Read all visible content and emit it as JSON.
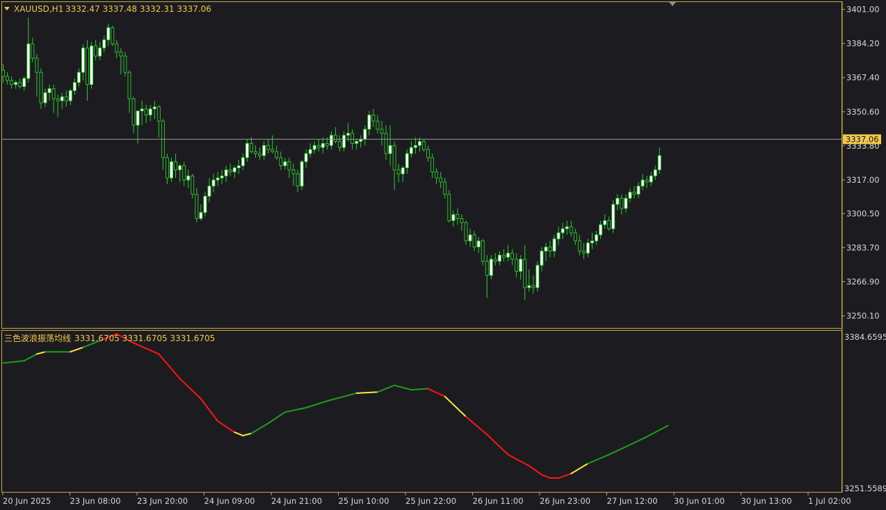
{
  "window": {
    "title_symbol": "XAUUSD,H1",
    "ohlc_text": "3332.47 3337.48 3332.31 3337.06"
  },
  "colors": {
    "background": "#1c1c20",
    "frame": "#c8a84b",
    "bull_candle": "#ffffff",
    "bear_candle": "#1c1c20",
    "wick": "#32c832",
    "price_line": "#9a9a9a",
    "price_tag_bg": "#f2c94c",
    "osc_green": "#1f9d1f",
    "osc_red": "#ff1414",
    "osc_yellow": "#ffe64a",
    "text": "#d8d8d8"
  },
  "indicator": {
    "name": "三色波浪振荡均线",
    "values_text": "3331.6705 3331.6705 3331.6705",
    "axis_max": "3384.6595",
    "axis_min": "3251.5589"
  },
  "current_price": {
    "label": "3337.06",
    "value": 3337.06
  },
  "time_labels": [
    "20 Jun 2025",
    "23 Jun 08:00",
    "23 Jun 20:00",
    "24 Jun 09:00",
    "24 Jun 21:00",
    "25 Jun 10:00",
    "25 Jun 22:00",
    "26 Jun 11:00",
    "26 Jun 23:00",
    "27 Jun 12:00",
    "30 Jun 01:00",
    "30 Jun 13:00",
    "1 Jul 02:00"
  ],
  "chart_data": {
    "type": "candlestick",
    "symbol": "XAUUSD",
    "timeframe": "H1",
    "y_ticks": [
      "3401.00",
      "3384.20",
      "3367.40",
      "3350.60",
      "3333.80",
      "3317.00",
      "3300.50",
      "3283.70",
      "3266.90",
      "3250.10"
    ],
    "ylim": [
      3246.5,
      3404.5
    ],
    "grid": false,
    "ohlc": [
      [
        3371,
        3374,
        3365,
        3368
      ],
      [
        3368,
        3370,
        3364,
        3366
      ],
      [
        3366,
        3368,
        3362,
        3364
      ],
      [
        3364,
        3366,
        3362,
        3365
      ],
      [
        3365,
        3367,
        3362,
        3363
      ],
      [
        3363,
        3368,
        3361,
        3367
      ],
      [
        3367,
        3397,
        3365,
        3384
      ],
      [
        3384,
        3387,
        3375,
        3377
      ],
      [
        3377,
        3379,
        3358,
        3370
      ],
      [
        3370,
        3372,
        3352,
        3355
      ],
      [
        3355,
        3362,
        3353,
        3360
      ],
      [
        3360,
        3364,
        3356,
        3362
      ],
      [
        3362,
        3364,
        3350,
        3357
      ],
      [
        3357,
        3359,
        3348,
        3356
      ],
      [
        3356,
        3360,
        3352,
        3358
      ],
      [
        3358,
        3361,
        3353,
        3356
      ],
      [
        3356,
        3362,
        3354,
        3361
      ],
      [
        3361,
        3367,
        3359,
        3365
      ],
      [
        3365,
        3372,
        3363,
        3370
      ],
      [
        3370,
        3384,
        3366,
        3382
      ],
      [
        3382,
        3386,
        3356,
        3364
      ],
      [
        3364,
        3385,
        3362,
        3383
      ],
      [
        3383,
        3386,
        3376,
        3378
      ],
      [
        3378,
        3385,
        3376,
        3382
      ],
      [
        3382,
        3388,
        3380,
        3386
      ],
      [
        3386,
        3394,
        3383,
        3392
      ],
      [
        3392,
        3393,
        3383,
        3384
      ],
      [
        3384,
        3386,
        3377,
        3380
      ],
      [
        3380,
        3382,
        3369,
        3378
      ],
      [
        3378,
        3380,
        3368,
        3370
      ],
      [
        3370,
        3371,
        3350,
        3357
      ],
      [
        3357,
        3358,
        3340,
        3344
      ],
      [
        3344,
        3346,
        3335,
        3351
      ],
      [
        3351,
        3356,
        3344,
        3352
      ],
      [
        3352,
        3354,
        3345,
        3349
      ],
      [
        3349,
        3354,
        3346,
        3352
      ],
      [
        3352,
        3356,
        3347,
        3353
      ],
      [
        3353,
        3354,
        3338,
        3346
      ],
      [
        3346,
        3347,
        3322,
        3328
      ],
      [
        3328,
        3330,
        3315,
        3318
      ],
      [
        3318,
        3328,
        3316,
        3326
      ],
      [
        3326,
        3330,
        3318,
        3322
      ],
      [
        3322,
        3325,
        3316,
        3324
      ],
      [
        3324,
        3326,
        3314,
        3317
      ],
      [
        3317,
        3322,
        3313,
        3319
      ],
      [
        3319,
        3320,
        3308,
        3310
      ],
      [
        3310,
        3313,
        3296,
        3298
      ],
      [
        3298,
        3305,
        3297,
        3301
      ],
      [
        3301,
        3311,
        3299,
        3309
      ],
      [
        3309,
        3318,
        3306,
        3314
      ],
      [
        3314,
        3320,
        3311,
        3317
      ],
      [
        3317,
        3321,
        3314,
        3318
      ],
      [
        3318,
        3322,
        3315,
        3319
      ],
      [
        3319,
        3324,
        3316,
        3322
      ],
      [
        3322,
        3325,
        3319,
        3321
      ],
      [
        3321,
        3324,
        3318,
        3323
      ],
      [
        3323,
        3327,
        3320,
        3324
      ],
      [
        3324,
        3330,
        3322,
        3328
      ],
      [
        3328,
        3337,
        3326,
        3335
      ],
      [
        3335,
        3338,
        3330,
        3331
      ],
      [
        3331,
        3334,
        3328,
        3330
      ],
      [
        3330,
        3333,
        3327,
        3329
      ],
      [
        3329,
        3336,
        3327,
        3334
      ],
      [
        3334,
        3337,
        3330,
        3332
      ],
      [
        3332,
        3339,
        3330,
        3331
      ],
      [
        3331,
        3334,
        3327,
        3328
      ],
      [
        3328,
        3331,
        3322,
        3324
      ],
      [
        3324,
        3328,
        3322,
        3326
      ],
      [
        3326,
        3328,
        3318,
        3322
      ],
      [
        3322,
        3325,
        3314,
        3320
      ],
      [
        3320,
        3322,
        3311,
        3314
      ],
      [
        3314,
        3327,
        3312,
        3326
      ],
      [
        3326,
        3332,
        3323,
        3330
      ],
      [
        3330,
        3335,
        3328,
        3332
      ],
      [
        3332,
        3336,
        3330,
        3334
      ],
      [
        3334,
        3337,
        3331,
        3333
      ],
      [
        3333,
        3338,
        3330,
        3335
      ],
      [
        3335,
        3338,
        3332,
        3334
      ],
      [
        3334,
        3341,
        3332,
        3339
      ],
      [
        3339,
        3343,
        3335,
        3336
      ],
      [
        3336,
        3339,
        3331,
        3333
      ],
      [
        3333,
        3341,
        3331,
        3339
      ],
      [
        3339,
        3345,
        3336,
        3340
      ],
      [
        3340,
        3342,
        3332,
        3335
      ],
      [
        3335,
        3337,
        3332,
        3336
      ],
      [
        3336,
        3339,
        3333,
        3337
      ],
      [
        3337,
        3344,
        3334,
        3342
      ],
      [
        3342,
        3351,
        3339,
        3349
      ],
      [
        3349,
        3352,
        3343,
        3346
      ],
      [
        3346,
        3349,
        3340,
        3342
      ],
      [
        3342,
        3346,
        3334,
        3340
      ],
      [
        3340,
        3344,
        3327,
        3330
      ],
      [
        3330,
        3344,
        3324,
        3334
      ],
      [
        3334,
        3336,
        3312,
        3322
      ],
      [
        3322,
        3325,
        3316,
        3320
      ],
      [
        3320,
        3324,
        3316,
        3323
      ],
      [
        3323,
        3332,
        3320,
        3330
      ],
      [
        3330,
        3336,
        3328,
        3333
      ],
      [
        3333,
        3338,
        3330,
        3334
      ],
      [
        3334,
        3338,
        3331,
        3336
      ],
      [
        3336,
        3337,
        3331,
        3332
      ],
      [
        3332,
        3334,
        3326,
        3328
      ],
      [
        3328,
        3330,
        3318,
        3321
      ],
      [
        3321,
        3323,
        3315,
        3318
      ],
      [
        3318,
        3321,
        3313,
        3316
      ],
      [
        3316,
        3318,
        3308,
        3310
      ],
      [
        3310,
        3312,
        3296,
        3297
      ],
      [
        3297,
        3302,
        3294,
        3300
      ],
      [
        3300,
        3303,
        3295,
        3298
      ],
      [
        3298,
        3300,
        3292,
        3296
      ],
      [
        3296,
        3297,
        3285,
        3287
      ],
      [
        3287,
        3293,
        3284,
        3290
      ],
      [
        3290,
        3292,
        3282,
        3284
      ],
      [
        3284,
        3289,
        3281,
        3287
      ],
      [
        3287,
        3288,
        3275,
        3277
      ],
      [
        3277,
        3280,
        3259,
        3270
      ],
      [
        3270,
        3280,
        3268,
        3278
      ],
      [
        3278,
        3281,
        3275,
        3277
      ],
      [
        3277,
        3282,
        3275,
        3280
      ],
      [
        3280,
        3283,
        3277,
        3279
      ],
      [
        3279,
        3285,
        3277,
        3281
      ],
      [
        3281,
        3283,
        3275,
        3278
      ],
      [
        3278,
        3281,
        3269,
        3272
      ],
      [
        3272,
        3280,
        3268,
        3278
      ],
      [
        3278,
        3285,
        3258,
        3264
      ],
      [
        3264,
        3273,
        3262,
        3265
      ],
      [
        3265,
        3270,
        3261,
        3264
      ],
      [
        3264,
        3277,
        3262,
        3275
      ],
      [
        3275,
        3284,
        3272,
        3282
      ],
      [
        3282,
        3286,
        3277,
        3284
      ],
      [
        3284,
        3287,
        3279,
        3282
      ],
      [
        3282,
        3290,
        3279,
        3288
      ],
      [
        3288,
        3294,
        3285,
        3291
      ],
      [
        3291,
        3296,
        3288,
        3293
      ],
      [
        3293,
        3297,
        3290,
        3294
      ],
      [
        3294,
        3297,
        3289,
        3291
      ],
      [
        3291,
        3293,
        3285,
        3287
      ],
      [
        3287,
        3290,
        3280,
        3282
      ],
      [
        3282,
        3286,
        3278,
        3281
      ],
      [
        3281,
        3288,
        3279,
        3286
      ],
      [
        3286,
        3291,
        3283,
        3287
      ],
      [
        3287,
        3292,
        3285,
        3290
      ],
      [
        3290,
        3297,
        3288,
        3295
      ],
      [
        3295,
        3300,
        3293,
        3297
      ],
      [
        3297,
        3299,
        3292,
        3293
      ],
      [
        3293,
        3307,
        3291,
        3305
      ],
      [
        3305,
        3310,
        3302,
        3308
      ],
      [
        3308,
        3310,
        3300,
        3303
      ],
      [
        3303,
        3310,
        3301,
        3308
      ],
      [
        3308,
        3313,
        3306,
        3311
      ],
      [
        3311,
        3314,
        3308,
        3310
      ],
      [
        3310,
        3316,
        3308,
        3314
      ],
      [
        3314,
        3320,
        3312,
        3317
      ],
      [
        3317,
        3319,
        3313,
        3316
      ],
      [
        3316,
        3321,
        3314,
        3319
      ],
      [
        3319,
        3324,
        3317,
        3322
      ],
      [
        3322,
        3333,
        3320,
        3329
      ]
    ],
    "oscillator": {
      "name": "三色波浪振荡均线",
      "ylim": [
        3251.5589,
        3384.6595
      ],
      "points": [
        [
          0,
          3362
        ],
        [
          5,
          3364
        ],
        [
          8,
          3370
        ],
        [
          10,
          3372
        ],
        [
          16,
          3372
        ],
        [
          19,
          3376
        ],
        [
          23,
          3382
        ],
        [
          27,
          3388
        ],
        [
          31,
          3380
        ],
        [
          37,
          3370
        ],
        [
          42,
          3348
        ],
        [
          47,
          3330
        ],
        [
          51,
          3310
        ],
        [
          55,
          3300
        ],
        [
          57,
          3297
        ],
        [
          59,
          3299
        ],
        [
          63,
          3308
        ],
        [
          67,
          3318
        ],
        [
          72,
          3322
        ],
        [
          77,
          3328
        ],
        [
          84,
          3335
        ],
        [
          89,
          3336
        ],
        [
          93,
          3342
        ],
        [
          97,
          3338
        ],
        [
          101,
          3339
        ],
        [
          105,
          3332
        ],
        [
          110,
          3314
        ],
        [
          115,
          3298
        ],
        [
          120,
          3280
        ],
        [
          125,
          3270
        ],
        [
          128,
          3262
        ],
        [
          130,
          3259
        ],
        [
          132,
          3259
        ],
        [
          135,
          3263
        ],
        [
          139,
          3272
        ],
        [
          144,
          3280
        ],
        [
          148,
          3287
        ],
        [
          153,
          3296
        ],
        [
          158,
          3306
        ]
      ],
      "segment_colors": [
        "green",
        "green",
        "yellow",
        "green",
        "yellow",
        "green",
        "red",
        "red",
        "red",
        "red",
        "red",
        "red",
        "red",
        "yellow",
        "yellow",
        "green",
        "green",
        "green",
        "green",
        "green",
        "yellow",
        "green",
        "green",
        "green",
        "red",
        "yellow",
        "red",
        "red",
        "red",
        "red",
        "red",
        "red",
        "red",
        "yellow",
        "green",
        "green",
        "green",
        "green",
        "green"
      ]
    }
  }
}
